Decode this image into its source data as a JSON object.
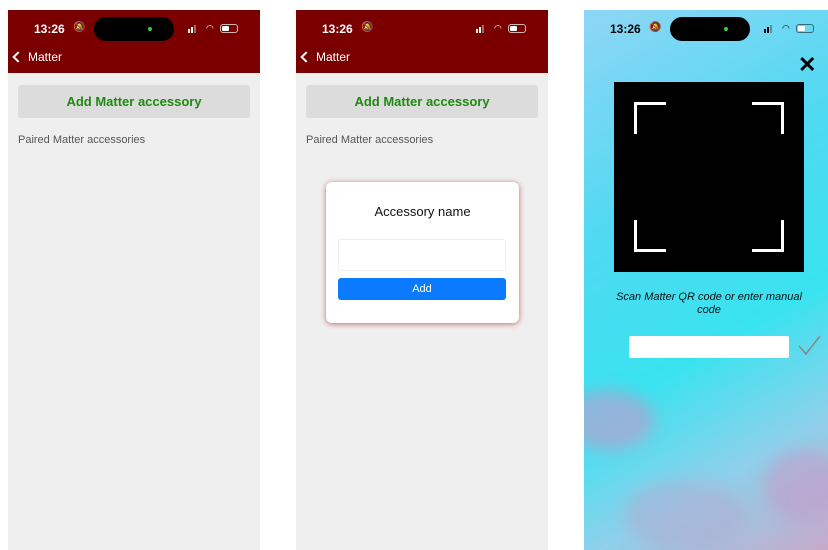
{
  "status_bar": {
    "time": "13:26"
  },
  "screens": [
    {
      "nav": {
        "back_label": "Matter"
      },
      "add_button_label": "Add Matter accessory",
      "section_label": "Paired Matter accessories"
    },
    {
      "nav": {
        "back_label": "Matter"
      },
      "add_button_label": "Add Matter accessory",
      "section_label": "Paired Matter accessories",
      "dialog": {
        "title": "Accessory name",
        "name_value": "",
        "submit_label": "Add"
      }
    },
    {
      "scan_instruction": "Scan Matter QR code or enter manual code",
      "manual_code_value": "",
      "icons": {
        "close": "close-icon",
        "confirm": "checkmark-icon"
      }
    }
  ],
  "colors": {
    "nav_background": "#7a0000",
    "add_button_text": "#1f8a10",
    "primary_button": "#0a7aff"
  }
}
